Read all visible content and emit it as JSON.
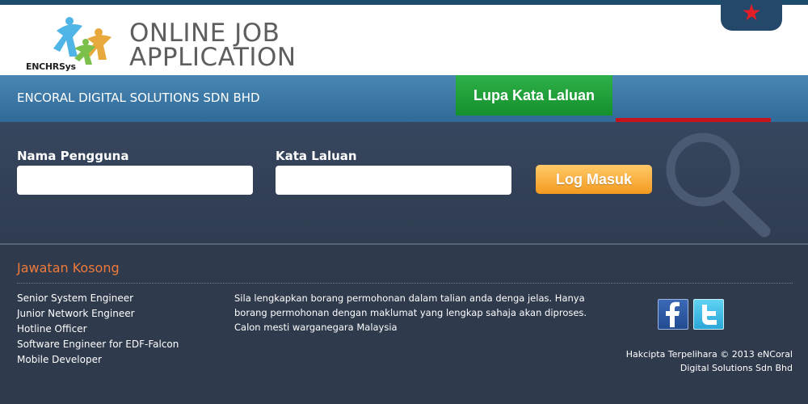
{
  "header": {
    "logo_text": "ENCHRSys",
    "title_line1": "ONLINE JOB",
    "title_line2": "APPLICATION"
  },
  "nav": {
    "company": "ENCORAL DIGITAL SOLUTIONS SDN BHD",
    "forgot_password": "Lupa Kata Laluan"
  },
  "login": {
    "username_label": "Nama Pengguna",
    "username_value": "",
    "password_label": "Kata Laluan",
    "password_value": "",
    "submit_label": "Log Masuk"
  },
  "vacancies": {
    "title": "Jawatan Kosong",
    "items": [
      "Senior System Engineer",
      "Junior Network Engineer",
      "Hotline Officer",
      "Software Engineer for EDF-Falcon",
      "Mobile Developer"
    ]
  },
  "notice": "Sila lengkapkan borang permohonan dalam talian anda denga jelas. Hanya borang permohonan dengan maklumat yang lengkap sahaja akan diproses. Calon mesti warganegara Malaysia",
  "social": {
    "facebook_icon": "facebook-icon",
    "twitter_icon": "twitter-icon"
  },
  "footer": {
    "copyright_line1": "Hakcipta Terpelihara © 2013 eNCoral",
    "copyright_line2": "Digital Solutions Sdn Bhd"
  },
  "colors": {
    "header_bg": "#ffffff",
    "blue_bar": "#3b78a6",
    "forgot_button": "#1fa23b",
    "login_button": "#f6a631",
    "footer_bg": "#2f3a4c",
    "section_title": "#f07a3a",
    "star": "#e21e26"
  },
  "icons": {
    "star": "star-icon",
    "search": "magnifier-icon"
  }
}
